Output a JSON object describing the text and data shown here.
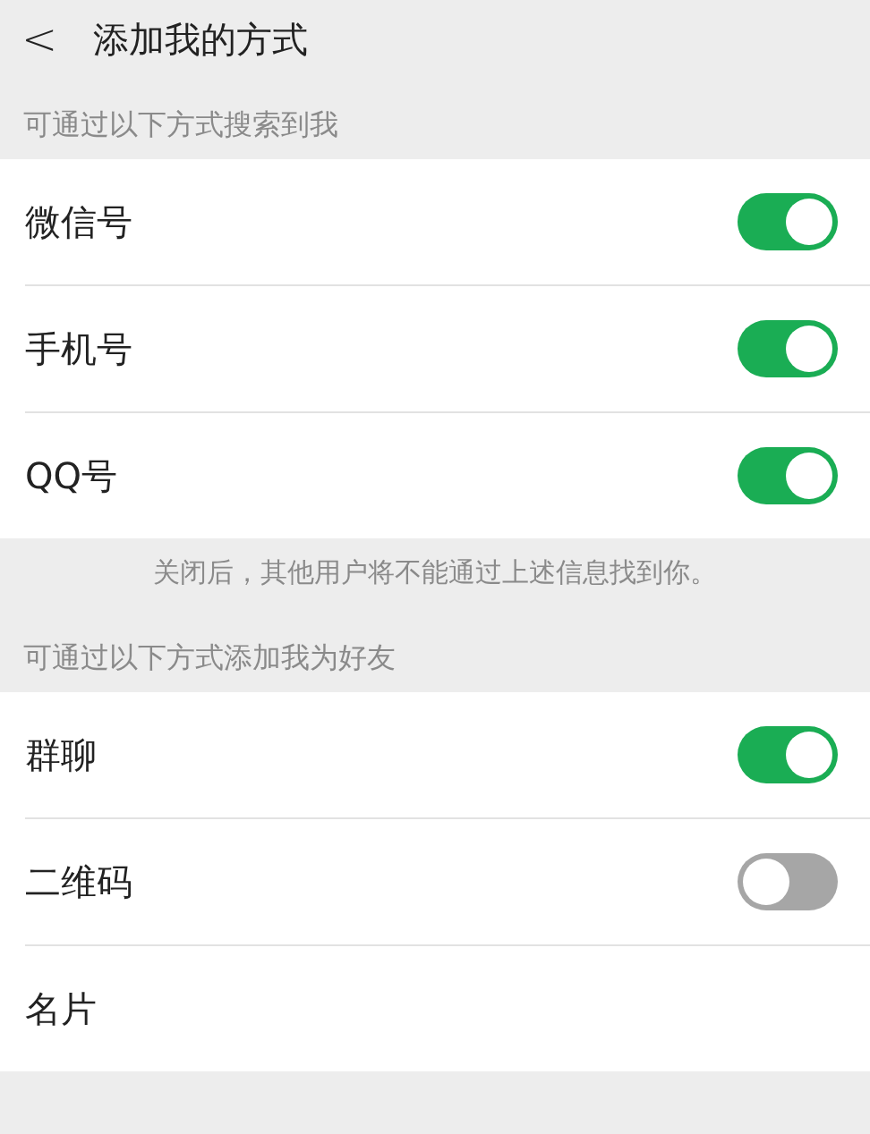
{
  "header": {
    "back_icon": "<",
    "title": "添加我的方式"
  },
  "sections": [
    {
      "label": "可通过以下方式搜索到我",
      "items": [
        {
          "kind": "toggle",
          "label": "微信号",
          "on": true
        },
        {
          "kind": "toggle",
          "label": "手机号",
          "on": true
        },
        {
          "kind": "toggle",
          "label": "QQ号",
          "on": true
        }
      ],
      "note": "关闭后，其他用户将不能通过上述信息找到你。"
    },
    {
      "label": "可通过以下方式添加我为好友",
      "items": [
        {
          "kind": "toggle",
          "label": "群聊",
          "on": true
        },
        {
          "kind": "toggle",
          "label": "二维码",
          "on": false
        },
        {
          "kind": "plain",
          "label": "名片"
        }
      ]
    }
  ]
}
